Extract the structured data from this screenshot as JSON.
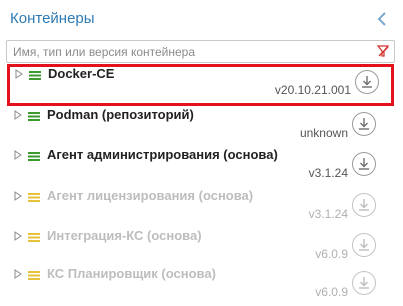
{
  "panel": {
    "title": "Контейнеры",
    "search_placeholder": "Имя, тип или версия контейнера"
  },
  "colors": {
    "accent": "#2e7bb4",
    "selection": "#e3111b",
    "enabled_icon": "#3a9a2c",
    "disabled_icon": "#e7c23b"
  },
  "containers": [
    {
      "name": "Docker-CE",
      "version": "v20.10.21.001",
      "enabled": true,
      "selected": true
    },
    {
      "name": "Podman (репозиторий)",
      "version": "unknown",
      "enabled": true,
      "selected": false
    },
    {
      "name": "Агент администрирования (основа)",
      "version": "v3.1.24",
      "enabled": true,
      "selected": false
    },
    {
      "name": "Агент лицензирования (основа)",
      "version": "v3.1.24",
      "enabled": false,
      "selected": false
    },
    {
      "name": "Интеграция-КС (основа)",
      "version": "v6.0.9",
      "enabled": false,
      "selected": false
    },
    {
      "name": "КС Планировщик (основа)",
      "version": "v6.0.9",
      "enabled": false,
      "selected": false
    }
  ]
}
